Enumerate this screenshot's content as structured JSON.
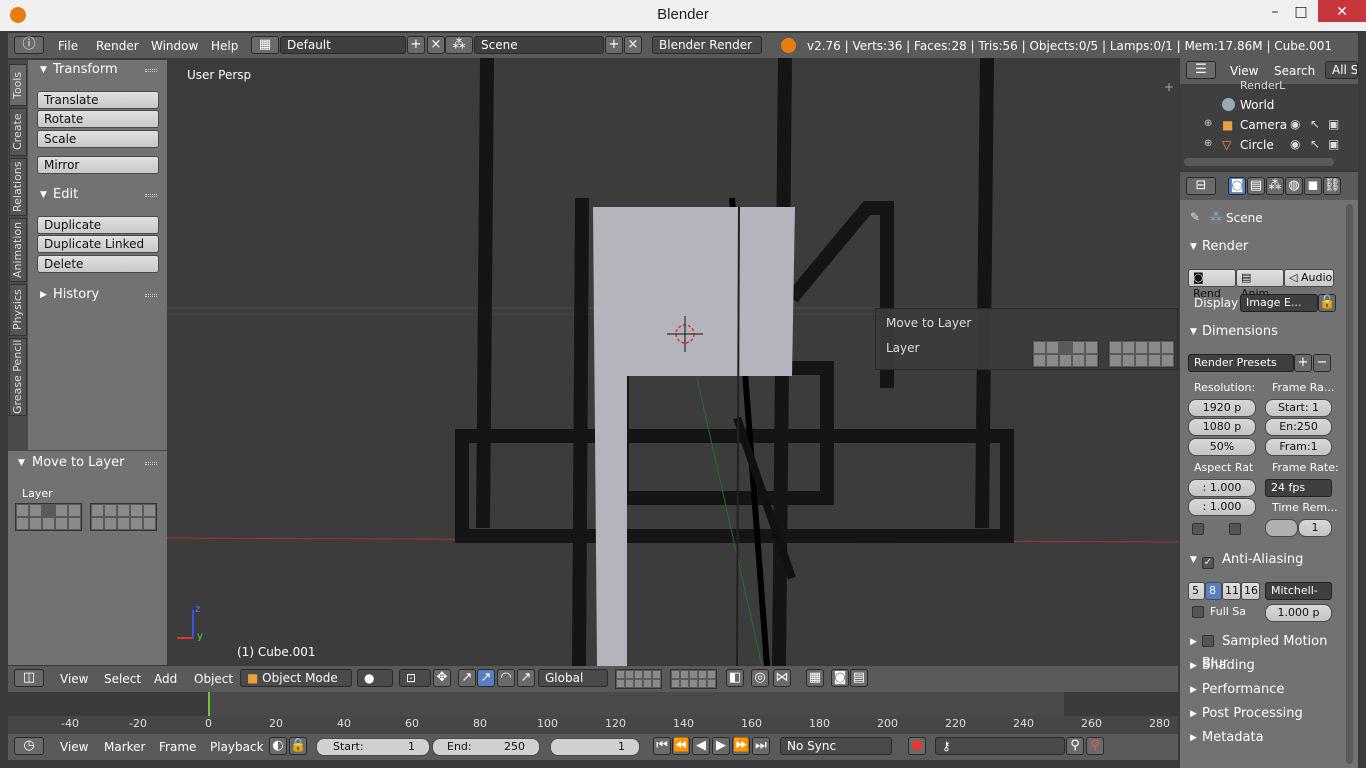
{
  "window": {
    "title": "Blender"
  },
  "infobar": {
    "menus": [
      "File",
      "Render",
      "Window",
      "Help"
    ],
    "layout": "Default",
    "scene": "Scene",
    "engine": "Blender Render",
    "stats": "v2.76 | Verts:36 | Faces:28 | Tris:56 | Objects:0/5 | Lamps:0/1 | Mem:17.86M | Cube.001"
  },
  "tabs": [
    "Tools",
    "Create",
    "Relations",
    "Animation",
    "Physics",
    "Grease Pencil"
  ],
  "toolshelf": {
    "transform": {
      "title": "Transform",
      "buttons": [
        "Translate",
        "Rotate",
        "Scale"
      ]
    },
    "mirror": "Mirror",
    "edit": {
      "title": "Edit",
      "buttons": [
        "Duplicate",
        "Duplicate Linked",
        "Delete"
      ]
    },
    "history": "History",
    "move_panel": {
      "title": "Move to Layer",
      "layer_label": "Layer"
    }
  },
  "viewport": {
    "label": "User Persp",
    "object_label": "(1) Cube.001",
    "popup": {
      "title": "Move to Layer",
      "layer_label": "Layer"
    }
  },
  "view_header": {
    "menus": [
      "View",
      "Select",
      "Add",
      "Object"
    ],
    "mode": "Object Mode",
    "orientation": "Global"
  },
  "timeline": {
    "ticks": [
      "-40",
      "-20",
      "0",
      "20",
      "40",
      "60",
      "80",
      "100",
      "120",
      "140",
      "160",
      "180",
      "200",
      "220",
      "240",
      "260",
      "280"
    ],
    "current_frame_tick": 0
  },
  "timeline_header": {
    "menus": [
      "View",
      "Marker",
      "Frame",
      "Playback"
    ],
    "start_label": "Start:",
    "start": "1",
    "end_label": "End:",
    "end": "250",
    "current": "1",
    "sync": "No Sync"
  },
  "outliner": {
    "menus": [
      "View",
      "Search"
    ],
    "filter": "All Sc",
    "items": [
      "RenderL",
      "World",
      "Camera",
      "Circle"
    ]
  },
  "properties": {
    "context": "Scene",
    "render_title": "Render",
    "render_buttons": [
      "Rend",
      "Anim",
      "Audio"
    ],
    "display_label": "Display",
    "display_value": "Image E...",
    "dimensions_title": "Dimensions",
    "render_presets": "Render Presets",
    "resolution_label": "Resolution:",
    "frame_range_label": "Frame Ra...",
    "res_x": "1920 p",
    "res_y": "1080 p",
    "res_pct": "50%",
    "frame_start": "Start: 1",
    "frame_end": "En:250",
    "frame_step": "Fram:1",
    "aspect_label": "Aspect Rat",
    "frame_rate_label": "Frame Rate:",
    "aspect_x": ": 1.000",
    "aspect_y": ": 1.000",
    "fps": "24 fps",
    "time_remap_label": "Time Rem...",
    "time_remap_value": "1",
    "aa_title": "Anti-Aliasing",
    "aa_samples": [
      "5",
      "8",
      "11",
      "16"
    ],
    "aa_filter": "Mitchell-",
    "full_sample_label": "Full Sa",
    "filter_size": "1.000 p",
    "collapsed_panels": [
      "Sampled Motion Blur",
      "Shading",
      "Performance",
      "Post Processing",
      "Metadata"
    ]
  },
  "colors": {
    "accent": "#5680c2",
    "viewport_bg": "#3c3c3c",
    "panel_bg": "#727272"
  }
}
